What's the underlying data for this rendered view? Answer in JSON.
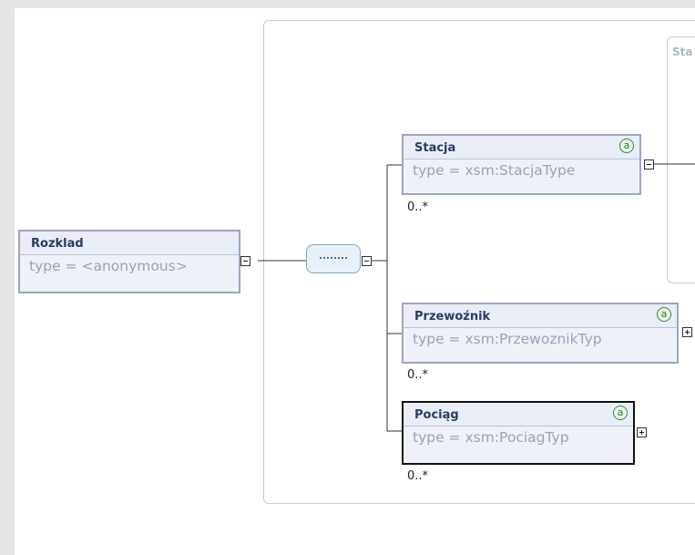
{
  "root_element": {
    "name": "Rozklad",
    "type": "type = <anonymous>"
  },
  "compositor": {
    "kind": "sequence"
  },
  "inner_group": {
    "label": "Sta"
  },
  "children": [
    {
      "name": "Stacja",
      "type": "type = xsm:StacjaType",
      "cardinality": "0..*",
      "attr_icon": "a",
      "toggle": "collapse",
      "selected": false
    },
    {
      "name": "Przewoźnik",
      "type": "type = xsm:PrzewoznikTyp",
      "cardinality": "0..*",
      "attr_icon": "a",
      "toggle": "expand",
      "selected": false
    },
    {
      "name": "Pociąg",
      "type": "type = xsm:PociagTyp",
      "cardinality": "0..*",
      "attr_icon": "a",
      "toggle": "expand",
      "selected": true
    }
  ]
}
